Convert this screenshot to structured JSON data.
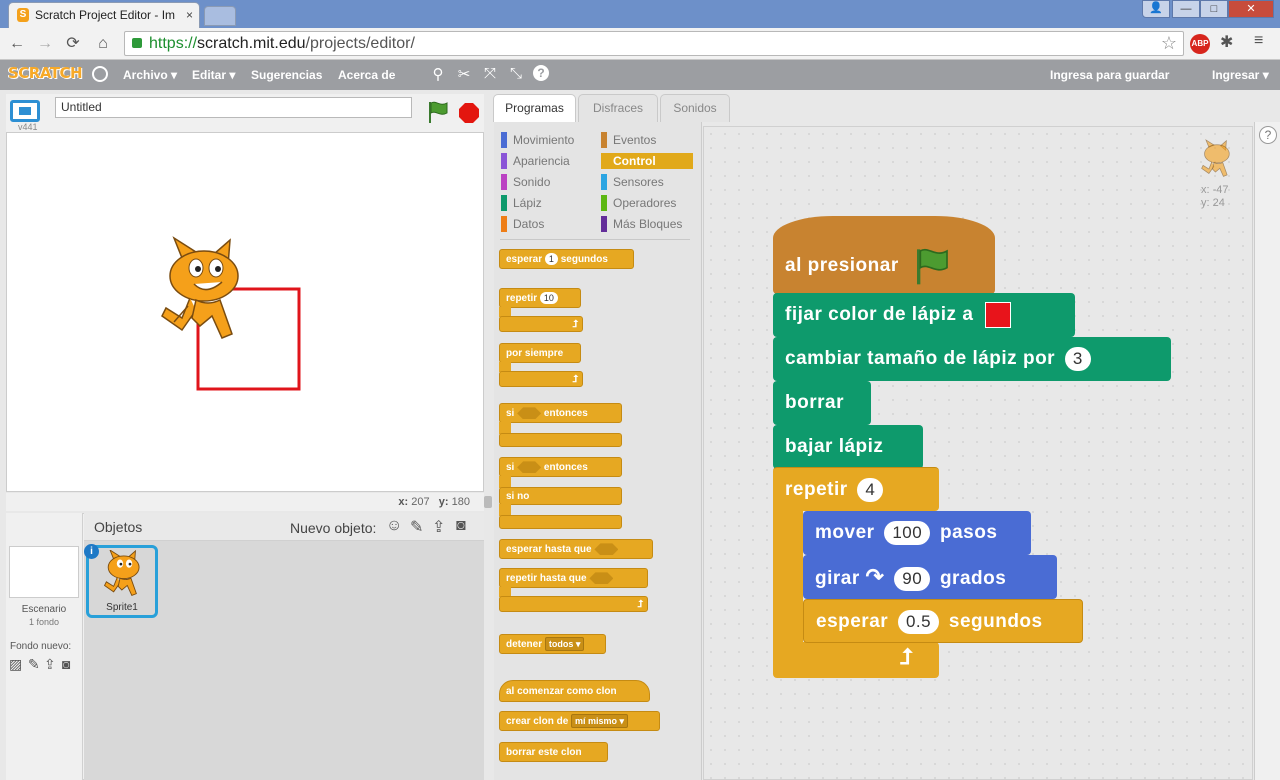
{
  "browser": {
    "tab_title": "Scratch Project Editor - Im",
    "tab_close": "×",
    "url_https": "https://",
    "url_host": "scratch.mit.edu",
    "url_path": "/projects/editor/",
    "abp": "ABP",
    "window_min": "—",
    "window_max": "□",
    "window_close": "✕"
  },
  "menubar": {
    "logo": "SCRATCH",
    "archivo": "Archivo ▾",
    "editar": "Editar ▾",
    "sugerencias": "Sugerencias",
    "acerca": "Acerca de",
    "save_login": "Ingresa para guardar",
    "ingresar": "Ingresar ▾"
  },
  "stage": {
    "version": "v441",
    "title_value": "Untitled",
    "coords_x_label": "x:",
    "coords_x": "207",
    "coords_y_label": "y:",
    "coords_y": "180"
  },
  "sprites": {
    "header": "Objetos",
    "new_object": "Nuevo objeto:",
    "scene_label": "Escenario",
    "scene_sub": "1 fondo",
    "new_backdrop": "Fondo nuevo:",
    "sprite1": "Sprite1",
    "info": "i"
  },
  "tabs": {
    "programas": "Programas",
    "disfraces": "Disfraces",
    "sonidos": "Sonidos"
  },
  "categories": [
    {
      "label": "Movimiento",
      "color": "#4a6cd4"
    },
    {
      "label": "Eventos",
      "color": "#c88330"
    },
    {
      "label": "Apariencia",
      "color": "#8a55d7"
    },
    {
      "label": "Control",
      "color": "#e1a91a"
    },
    {
      "label": "Sonido",
      "color": "#bb42c3"
    },
    {
      "label": "Sensores",
      "color": "#2ca5e2"
    },
    {
      "label": "Lápiz",
      "color": "#0e9a6c"
    },
    {
      "label": "Operadores",
      "color": "#5cb712"
    },
    {
      "label": "Datos",
      "color": "#ee7d16"
    },
    {
      "label": "Más Bloques",
      "color": "#632d99"
    }
  ],
  "palette": {
    "esperar": "esperar",
    "esperar_val": "1",
    "segundos": "segundos",
    "repetir": "repetir",
    "repetir_val": "10",
    "por_siempre": "por siempre",
    "si": "si",
    "entonces": "entonces",
    "si_no": "si no",
    "esperar_hasta": "esperar hasta que",
    "repetir_hasta": "repetir hasta que",
    "detener": "detener",
    "detener_opt": "todos ▾",
    "al_comenzar": "al comenzar como clon",
    "crear_clon": "crear clon de",
    "crear_clon_opt": "mí mismo ▾",
    "borrar_clon": "borrar este clon"
  },
  "script": {
    "al_presionar": "al presionar",
    "fijar_color": "fijar color de lápiz a",
    "pen_color": "#e8141b",
    "cambiar_tamano": "cambiar tamaño de lápiz por",
    "cambiar_val": "3",
    "borrar": "borrar",
    "bajar_lapiz": "bajar lápiz",
    "repetir": "repetir",
    "repetir_val": "4",
    "mover": "mover",
    "mover_val": "100",
    "pasos": "pasos",
    "girar": "girar",
    "girar_val": "90",
    "grados": "grados",
    "esperar": "esperar",
    "esperar_val": "0.5",
    "segundos": "segundos"
  },
  "sprite_info": {
    "x_label": "x:",
    "x": "-47",
    "y_label": "y:",
    "y": "24"
  },
  "colors": {
    "control": "#e6a822",
    "events": "#c88330",
    "pen": "#0e9a6c",
    "motion": "#4a6cd4"
  }
}
